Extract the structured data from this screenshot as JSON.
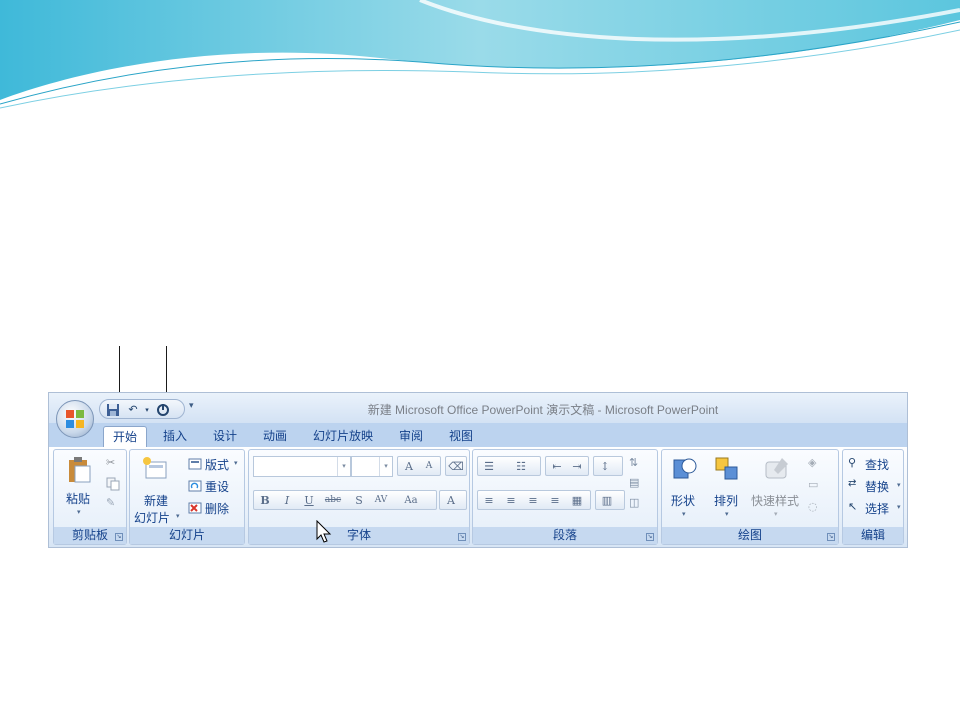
{
  "window": {
    "title": "新建 Microsoft Office PowerPoint 演示文稿 - Microsoft PowerPoint"
  },
  "quick_access": {
    "icons": [
      "save-icon",
      "undo-icon",
      "undo-dropdown-icon",
      "redo-icon",
      "customize-qat-icon"
    ]
  },
  "tabs": [
    {
      "label": "开始",
      "active": true
    },
    {
      "label": "插入",
      "active": false
    },
    {
      "label": "设计",
      "active": false
    },
    {
      "label": "动画",
      "active": false
    },
    {
      "label": "幻灯片放映",
      "active": false
    },
    {
      "label": "审阅",
      "active": false
    },
    {
      "label": "视图",
      "active": false
    }
  ],
  "groups": {
    "clipboard": {
      "label": "剪贴板",
      "paste": "粘贴",
      "icons": [
        "paste-icon",
        "cut-icon",
        "copy-icon",
        "format-painter-icon"
      ]
    },
    "slides": {
      "label": "幻灯片",
      "new_slide_line1": "新建",
      "new_slide_line2": "幻灯片",
      "layout": "版式",
      "reset": "重设",
      "delete": "删除"
    },
    "font": {
      "label": "字体",
      "format_buttons": [
        "B",
        "I",
        "U",
        "abc",
        "S",
        "AV",
        "Aa",
        "A"
      ],
      "grow_font": "A",
      "shrink_font": "A"
    },
    "paragraph": {
      "label": "段落"
    },
    "drawing": {
      "label": "绘图",
      "shapes": "形状",
      "arrange": "排列",
      "quick_styles": "快速样式"
    },
    "editing": {
      "label": "编辑",
      "find": "查找",
      "replace": "替换",
      "select": "选择"
    }
  },
  "colors": {
    "ribbon_blue": "#dbe8f7",
    "label_blue": "#15428b",
    "tab_bar": "#bcd3ef"
  }
}
